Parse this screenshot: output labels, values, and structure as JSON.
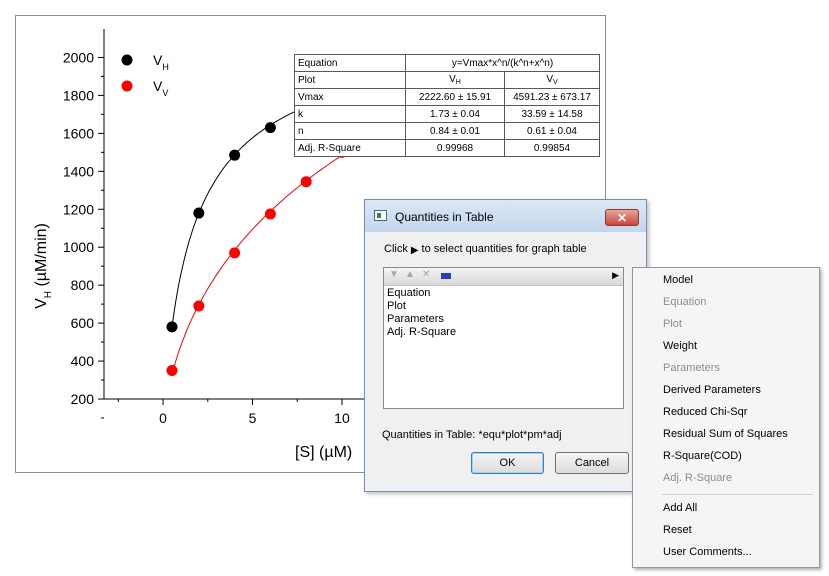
{
  "graph": {
    "xlabel_prefix": "[S] (",
    "xlabel_unit": "µM",
    "xlabel_suffix": ")",
    "ylabel_main": "V",
    "ylabel_sub": "H",
    "ylabel_rest": " (µM/min)",
    "legend": [
      {
        "main": "V",
        "sub": "H",
        "color": "#000000"
      },
      {
        "main": "V",
        "sub": "V",
        "color": "#ff0000"
      }
    ]
  },
  "chart_data": {
    "type": "scatter",
    "x_ticks": [
      "0",
      "5",
      "10"
    ],
    "y_ticks": [
      "200",
      "400",
      "600",
      "800",
      "1000",
      "1200",
      "1400",
      "1600",
      "1800",
      "2000"
    ],
    "series": [
      {
        "name": "VH",
        "color": "#000000",
        "x": [
          0.5,
          2,
          4,
          6
        ],
        "y": [
          580,
          1180,
          1485,
          1630
        ]
      },
      {
        "name": "VV",
        "color": "#ff0000",
        "x": [
          0.5,
          2,
          4,
          6,
          8,
          10
        ],
        "y": [
          350,
          690,
          970,
          1175,
          1345,
          1500
        ]
      }
    ],
    "fits": [
      {
        "color": "#000000",
        "Vmax": 2222.6,
        "k": 1.73,
        "n": 0.84
      },
      {
        "color": "#ff0000",
        "Vmax": 4591.23,
        "k": 33.59,
        "n": 0.61
      }
    ]
  },
  "table": {
    "equation_label": "Equation",
    "equation_value": "y=Vmax*x^n/(k^n+x^n)",
    "plot_label": "Plot",
    "plot_v1_main": "V",
    "plot_v1_sub": "H",
    "plot_v2_main": "V",
    "plot_v2_sub": "V",
    "rows": [
      {
        "label": "Vmax",
        "v1": "2222.60 ± 15.91",
        "v2": "4591.23 ± 673.17"
      },
      {
        "label": "k",
        "v1": "1.73 ± 0.04",
        "v2": "33.59 ± 14.58"
      },
      {
        "label": "n",
        "v1": "0.84 ± 0.01",
        "v2": "0.61 ± 0.04"
      },
      {
        "label": "Adj. R-Square",
        "v1": "0.99968",
        "v2": "0.99854"
      }
    ]
  },
  "dialog": {
    "title": "Quantities in Table",
    "close_glyph": "✕",
    "instruction_pre": "Click",
    "instruction_post": "to select quantities for graph table",
    "list_items": [
      "Equation",
      "Plot",
      "Parameters",
      "Adj. R-Square"
    ],
    "quantities_label": "Quantities in Table: *equ*plot*pm*adj",
    "ok_label": "OK",
    "cancel_label": "Cancel"
  },
  "context_menu": {
    "items": [
      {
        "label": "Model",
        "enabled": true
      },
      {
        "label": "Equation",
        "enabled": false
      },
      {
        "label": "Plot",
        "enabled": false
      },
      {
        "label": "Weight",
        "enabled": true
      },
      {
        "label": "Parameters",
        "enabled": false
      },
      {
        "label": "Derived Parameters",
        "enabled": true
      },
      {
        "label": "Reduced Chi-Sqr",
        "enabled": true
      },
      {
        "label": "Residual Sum of Squares",
        "enabled": true
      },
      {
        "label": "R-Square(COD)",
        "enabled": true
      },
      {
        "label": "Adj. R-Square",
        "enabled": false
      }
    ],
    "items_after_separator": [
      {
        "label": "Add All",
        "enabled": true
      },
      {
        "label": "Reset",
        "enabled": true
      },
      {
        "label": "User Comments...",
        "enabled": true
      }
    ]
  }
}
